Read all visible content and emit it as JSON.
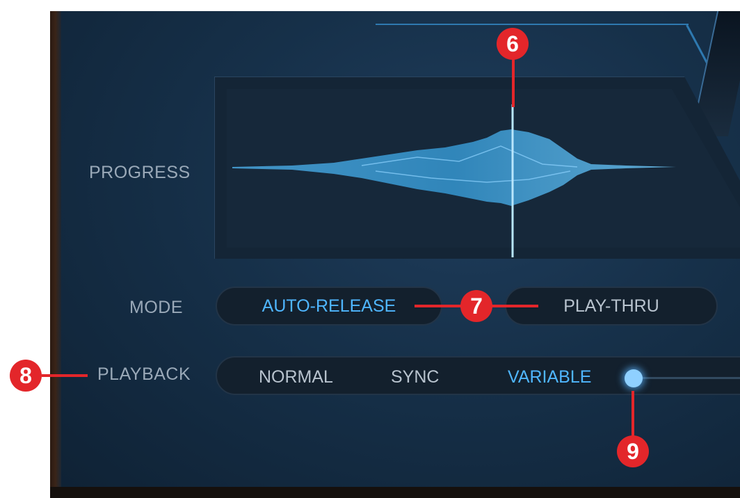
{
  "labels": {
    "progress": "PROGRESS",
    "mode": "MODE",
    "playback": "PLAYBACK"
  },
  "mode": {
    "options": [
      {
        "label": "AUTO-RELEASE",
        "active": true
      },
      {
        "label": "PLAY-THRU",
        "active": false
      }
    ]
  },
  "playback": {
    "options": [
      "NORMAL",
      "SYNC",
      "VARIABLE"
    ],
    "selected": "VARIABLE"
  },
  "callouts": [
    "6",
    "7",
    "8",
    "9"
  ],
  "colors": {
    "accent": "#4fb6ff",
    "callout": "#e3262a",
    "panel": "#163049",
    "waveform": "#3a9fd8"
  },
  "icons": {
    "playhead": "vertical-line",
    "slider_knob": "glowing-dot"
  }
}
